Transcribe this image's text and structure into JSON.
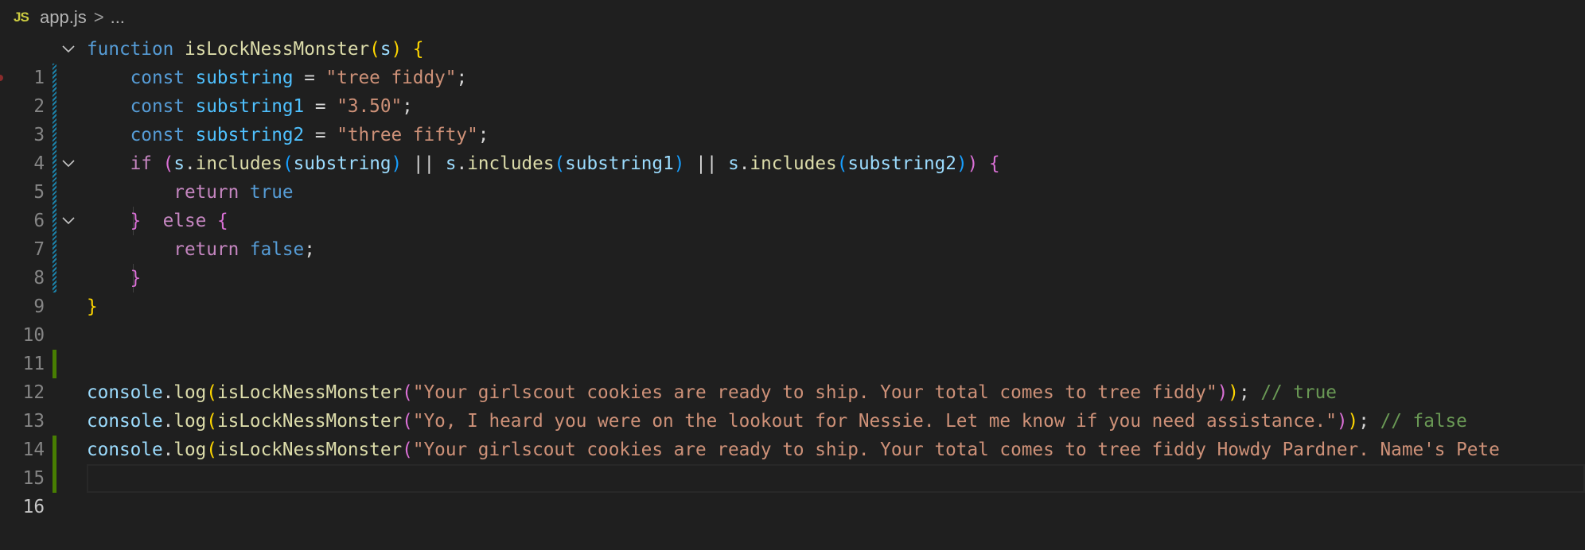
{
  "breadcrumb": {
    "icon_text": "JS",
    "file": "app.js",
    "separator": ">",
    "more": "..."
  },
  "gutter": {
    "line_numbers": [
      "1",
      "2",
      "3",
      "4",
      "5",
      "6",
      "7",
      "8",
      "9",
      "10",
      "11",
      "12",
      "13",
      "14",
      "15",
      "16"
    ],
    "active_line": 16
  },
  "code": {
    "l1": {
      "kw": "function",
      "fn": "isLockNessMonster",
      "open": "(",
      "param": "s",
      "close": ")",
      "brace": "{"
    },
    "l2": {
      "kw": "const",
      "name": "substring",
      "eq": " = ",
      "value": "\"tree fiddy\"",
      "semi": ";"
    },
    "l3": {
      "kw": "const",
      "name": "substring1",
      "eq": " = ",
      "value": "\"3.50\"",
      "semi": ";"
    },
    "l4": {
      "kw": "const",
      "name": "substring2",
      "eq": " = ",
      "value": "\"three fifty\"",
      "semi": ";"
    },
    "l5": {
      "kw": "if",
      "open": "(",
      "obj1": "s",
      "call1": "includes",
      "arg1": "substring",
      "or1": " || ",
      "obj2": "s",
      "call2": "includes",
      "arg2": "substring1",
      "or2": " || ",
      "obj3": "s",
      "call3": "includes",
      "arg3": "substring2",
      "close": ")",
      "brace": "{"
    },
    "l6": {
      "kw": "return",
      "value": "true"
    },
    "l7": {
      "close": "}",
      "kw": "else",
      "brace": "{"
    },
    "l8": {
      "kw": "return",
      "value": "false",
      "semi": ";"
    },
    "l9": {
      "close": "}"
    },
    "l10": {
      "close": "}"
    },
    "l13": {
      "obj": "console",
      "method": "log",
      "fn": "isLockNessMonster",
      "arg": "\"Your girlscout cookies are ready to ship. Your total comes to tree fiddy\"",
      "tail": ");",
      "comment": "// true"
    },
    "l14": {
      "obj": "console",
      "method": "log",
      "fn": "isLockNessMonster",
      "arg": "\"Yo, I heard you were on the lookout for Nessie. Let me know if you need assistance.\"",
      "tail": ");",
      "comment": "// false"
    },
    "l15": {
      "obj": "console",
      "method": "log",
      "fn": "isLockNessMonster",
      "arg": "\"Your girlscout cookies are ready to ship. Your total comes to tree fiddy Howdy Pardner. Name's Pete"
    }
  },
  "colors": {
    "background": "#1f1f1f",
    "keyword": "#569cd6",
    "function": "#dcdcaa",
    "variable": "#9cdcfe",
    "string": "#ce9178",
    "control": "#c586c0",
    "comment": "#6a9955",
    "gutter_modified": "#1b81a8",
    "gutter_added": "#487e02"
  }
}
